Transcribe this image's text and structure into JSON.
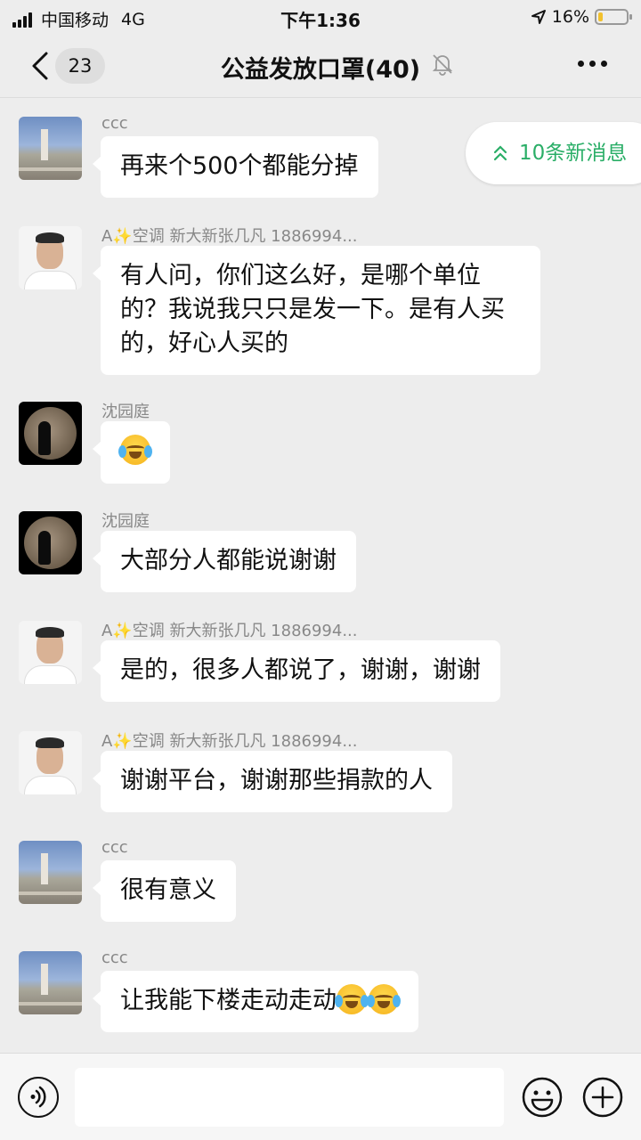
{
  "status_bar": {
    "carrier": "中国移动",
    "network": "4G",
    "time": "下午1:36",
    "battery": "16%",
    "battery_level": 0.16
  },
  "nav": {
    "unread_count": "23",
    "title": "公益发放口罩(40)"
  },
  "new_messages": {
    "label": "10条新消息"
  },
  "messages": [
    {
      "sender": "ccc",
      "text": "再来个500个都能分掉",
      "avatar": "avatar-ccc"
    },
    {
      "sender": "A✨空调 新大新张几凡 1886994...",
      "text": "有人问，你们这么好，是哪个单位的？我说我只只是发一下。是有人买的，好心人买的",
      "avatar": "avatar-man"
    },
    {
      "sender": "沈园庭",
      "text": "",
      "emoji": "crying-laughing-emoji",
      "avatar": "avatar-moon"
    },
    {
      "sender": "沈园庭",
      "text": "大部分人都能说谢谢",
      "avatar": "avatar-moon"
    },
    {
      "sender": "A✨空调 新大新张几凡 1886994...",
      "text": "是的，很多人都说了，谢谢，谢谢",
      "avatar": "avatar-man"
    },
    {
      "sender": "A✨空调 新大新张几凡 1886994...",
      "text": "谢谢平台，谢谢那些捐款的人",
      "avatar": "avatar-man"
    },
    {
      "sender": "ccc",
      "text": "很有意义",
      "avatar": "avatar-ccc"
    },
    {
      "sender": "ccc",
      "text": "让我能下楼走动走动",
      "emoji": "crying-laughing-emoji x2",
      "avatar": "avatar-ccc"
    }
  ],
  "input_bar": {
    "placeholder": ""
  },
  "colors": {
    "background": "#ededed",
    "bubble": "#ffffff",
    "accent_green": "#2aae67"
  }
}
